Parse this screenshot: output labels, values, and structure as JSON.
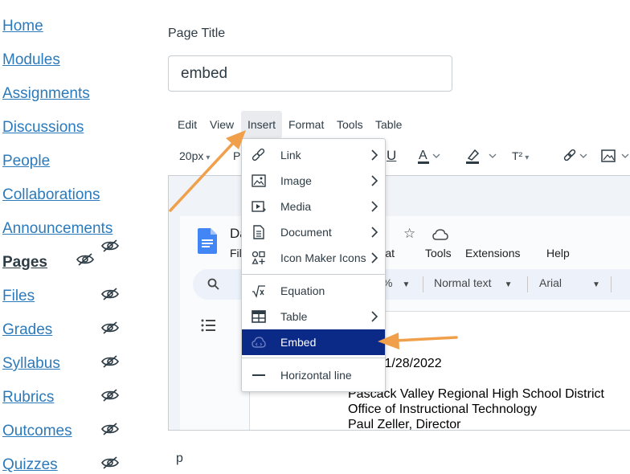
{
  "nav": {
    "items": [
      {
        "label": "Home"
      },
      {
        "label": "Modules"
      },
      {
        "label": "Assignments"
      },
      {
        "label": "Discussions"
      },
      {
        "label": "People"
      },
      {
        "label": "Collaborations"
      },
      {
        "label": "Announcements"
      },
      {
        "label": "Pages"
      },
      {
        "label": "Files"
      },
      {
        "label": "Grades"
      },
      {
        "label": "Syllabus"
      },
      {
        "label": "Rubrics"
      },
      {
        "label": "Outcomes"
      },
      {
        "label": "Quizzes"
      }
    ],
    "active": "Pages",
    "hidden_icon": "eye-slash-icon"
  },
  "page_title": {
    "label": "Page Title",
    "value": "embed"
  },
  "editor": {
    "menubar": [
      "Edit",
      "View",
      "Insert",
      "Format",
      "Tools",
      "Table"
    ],
    "open_menu": "Insert",
    "toolbar": {
      "font_size": "20px",
      "paragraph_abbrev": "Pa",
      "superscript": "T²"
    },
    "insert_menu": [
      {
        "label": "Link",
        "icon": "link-icon",
        "submenu": true
      },
      {
        "label": "Image",
        "icon": "image-icon",
        "submenu": true
      },
      {
        "label": "Media",
        "icon": "media-icon",
        "submenu": true
      },
      {
        "label": "Document",
        "icon": "document-icon",
        "submenu": true
      },
      {
        "label": "Icon Maker Icons",
        "icon": "icon-maker-icon",
        "submenu": true
      },
      {
        "label": "Equation",
        "icon": "equation-icon",
        "submenu": false
      },
      {
        "label": "Table",
        "icon": "table-icon",
        "submenu": true
      },
      {
        "label": "Embed",
        "icon": "cloud-embed-icon",
        "submenu": false,
        "selected": true
      },
      {
        "label": "Horizontal line",
        "icon": "horizontal-line-icon",
        "submenu": false
      }
    ],
    "body_text": "p"
  },
  "embedded_doc": {
    "title_start": "Da",
    "title_end": "d",
    "menu": {
      "file_abbrev": "Fil",
      "format_partial": "rmat",
      "tools": "Tools",
      "extensions": "Extensions",
      "help": "Help"
    },
    "toolbar": {
      "zoom_partial": "%",
      "style": "Normal text",
      "font": "Arial"
    },
    "content": {
      "date_line": "- 11/28/2022",
      "line1": "Pascack Valley Regional High School District",
      "line2": "Office of Instructional Technology",
      "line3": "Paul Zeller, Director"
    }
  },
  "colors": {
    "link": "#2b7abc",
    "selected_item_bg": "#0b2987",
    "annotation_arrow": "#f0a04b",
    "gdoc_blue": "#4285f4"
  }
}
